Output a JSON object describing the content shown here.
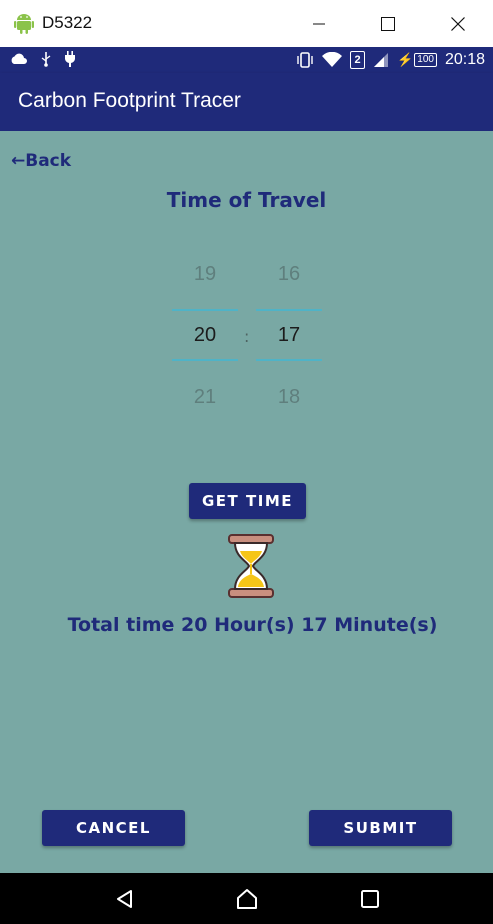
{
  "window": {
    "title": "D5322"
  },
  "status_bar": {
    "time": "20:18",
    "sim": "2",
    "battery": "100"
  },
  "app_bar": {
    "title": "Carbon Footprint Tracer"
  },
  "main": {
    "back_label": "←Back",
    "heading": "Time of Travel",
    "time_picker": {
      "hours": {
        "prev": "19",
        "selected": "20",
        "next": "21"
      },
      "minutes": {
        "prev": "16",
        "selected": "17",
        "next": "18"
      },
      "separator": ":"
    },
    "get_time_label": "GET TIME",
    "total_text": "Total time 20 Hour(s) 17 Minute(s)",
    "cancel_label": "CANCEL",
    "submit_label": "SUBMIT"
  },
  "colors": {
    "primary": "#1f2a7a",
    "background": "#79a8a4",
    "picker_line": "#4fb3c7"
  },
  "icons": [
    "android-icon",
    "minimize-icon",
    "maximize-icon",
    "close-icon",
    "cloud-icon",
    "usb-icon",
    "plug-icon",
    "vibrate-icon",
    "wifi-icon",
    "signal-icon",
    "battery-icon",
    "hourglass-icon",
    "back-nav-icon",
    "home-nav-icon",
    "recents-nav-icon"
  ]
}
